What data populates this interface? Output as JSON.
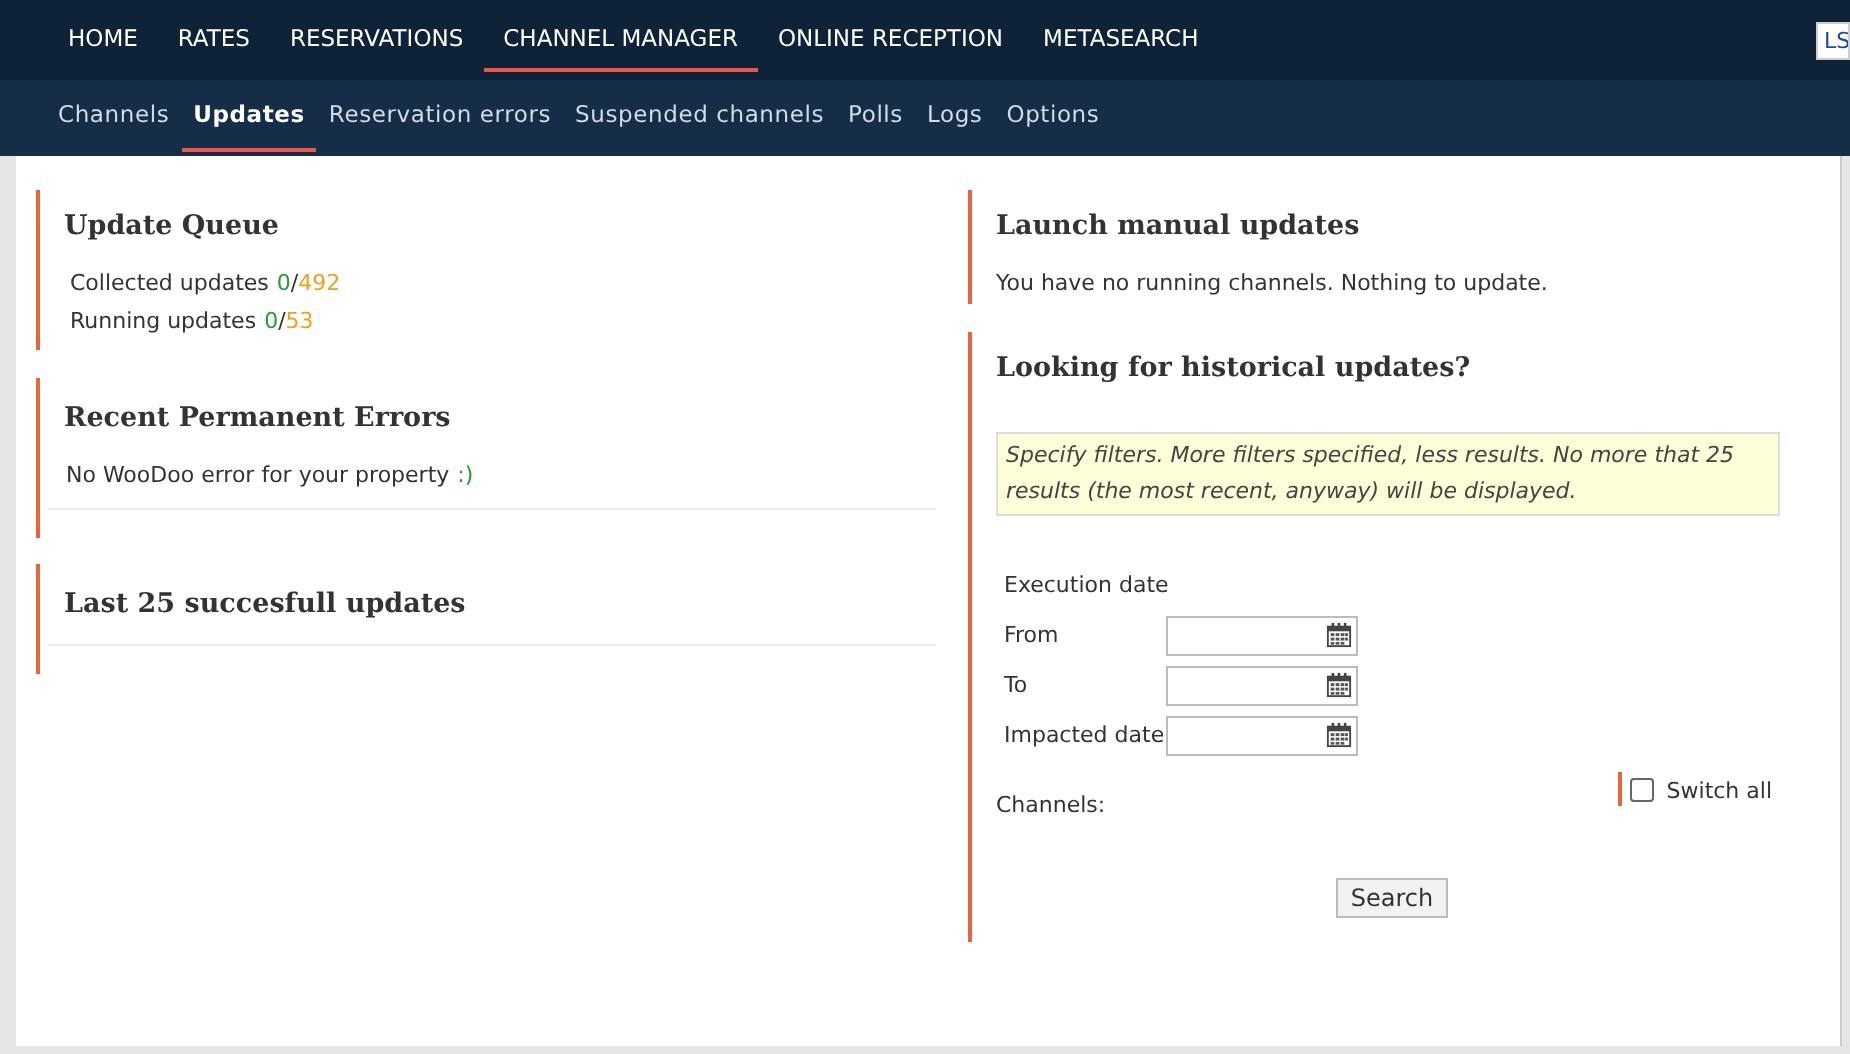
{
  "main_nav": [
    {
      "label": "HOME",
      "selected": false
    },
    {
      "label": "RATES",
      "selected": false
    },
    {
      "label": "RESERVATIONS",
      "selected": false
    },
    {
      "label": "CHANNEL MANAGER",
      "selected": true
    },
    {
      "label": "ONLINE RECEPTION",
      "selected": false
    },
    {
      "label": "METASEARCH",
      "selected": false
    }
  ],
  "language_button": "LS",
  "sub_nav": [
    {
      "label": "Channels",
      "selected": false
    },
    {
      "label": "Updates",
      "selected": true
    },
    {
      "label": "Reservation errors",
      "selected": false
    },
    {
      "label": "Suspended channels",
      "selected": false
    },
    {
      "label": "Polls",
      "selected": false
    },
    {
      "label": "Logs",
      "selected": false
    },
    {
      "label": "Options",
      "selected": false
    }
  ],
  "update_queue": {
    "title": "Update Queue",
    "rows": [
      {
        "label": "Collected updates",
        "done": "0",
        "separator": "/",
        "total": "492"
      },
      {
        "label": "Running updates",
        "done": "0",
        "separator": "/",
        "total": "53"
      }
    ]
  },
  "permanent_errors": {
    "title": "Recent Permanent Errors",
    "message": "No WooDoo error for your property",
    "emoticon": ":)"
  },
  "last_updates": {
    "title": "Last 25 succesfull updates"
  },
  "manual_updates": {
    "title": "Launch manual updates",
    "message": "You have no running channels. Nothing to update."
  },
  "historical": {
    "title": "Looking for historical updates?",
    "note": "Specify filters. More filters specified, less results. No more that 25 results (the most recent, anyway) will be displayed.",
    "group_label": "Execution date",
    "date_fields": [
      {
        "label": "From"
      },
      {
        "label": "To"
      },
      {
        "label": "Impacted date"
      }
    ],
    "channels_label": "Channels:",
    "switch_all": {
      "label": "Switch all",
      "checked": false
    },
    "search_button": "Search"
  }
}
